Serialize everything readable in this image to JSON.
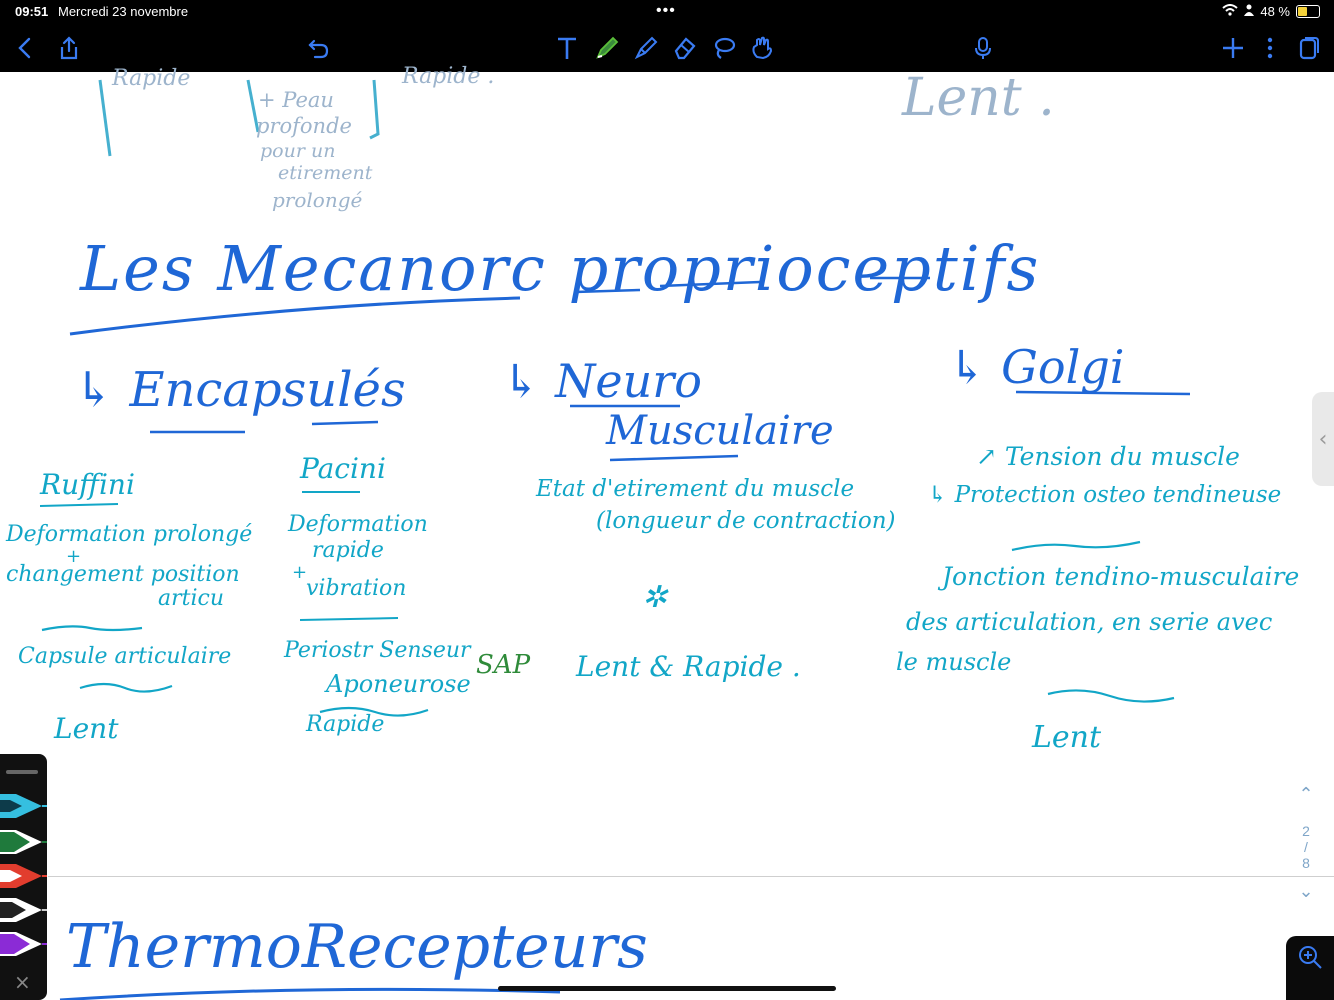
{
  "status": {
    "time": "09:51",
    "date": "Mercredi 23 novembre",
    "battery": "48 %",
    "dots": "•••"
  },
  "toolbar": {
    "left": [
      "back-icon",
      "share-icon",
      "undo-icon"
    ],
    "tools": [
      "text-tool-icon",
      "pen-tool-icon",
      "highlighter-tool-icon",
      "eraser-tool-icon",
      "lasso-tool-icon",
      "hand-tool-icon"
    ],
    "right": [
      "microphone-icon",
      "add-icon",
      "more-icon",
      "pages-icon"
    ]
  },
  "colors": {
    "ink_blue": "#1f67d6",
    "ink_cyan": "#12a6c7",
    "ink_faded": "#9db4cc",
    "ink_green": "#2f8b3a",
    "pen_cyan": "#35bfe0",
    "pen_green": "#1f7a3c",
    "pen_red": "#e23d2e",
    "pen_black": "#222222",
    "pen_purple": "#8b2bd6"
  },
  "notes": {
    "top_faded": {
      "rapide": "Rapide",
      "peau": "+ Peau",
      "profonde": "profonde",
      "pour_un": "pour un",
      "etirement": "etirement",
      "prolonge": "prolongé",
      "rapide2": "Rapide .",
      "lent": "Lent ."
    },
    "title": "Les Mecanorc proprioceptifs",
    "sections": {
      "encapsules": "↳ Encapsulés",
      "neuro": "↳ Neuro",
      "musculaire": "Musculaire",
      "golgi": "↳ Golgi"
    },
    "ruffini": {
      "name": "Ruffini",
      "line1": "Deformation prolongé",
      "plus": "+",
      "line2": "changement position",
      "line3": "articu",
      "location": "Capsule articulaire",
      "speed": "Lent"
    },
    "pacini": {
      "name": "Pacini",
      "line1": "Deformation",
      "line2": "rapide",
      "plus": "+",
      "line3": "vibration",
      "location": "Periostr Senseur",
      "location2": "Aponeurose",
      "sap": "SAP",
      "speed": "Rapide"
    },
    "neuro": {
      "line1": "Etat d'etirement du muscle",
      "line2": "(longueur de contraction)",
      "star": "✲",
      "speed": "Lent & Rapide ."
    },
    "golgi": {
      "line1": "↗ Tension du muscle",
      "line2": "↳ Protection osteo tendineuse",
      "line3": "Jonction tendino-musculaire",
      "line4": "des articulation, en serie avec",
      "line5": "le muscle",
      "speed": "Lent"
    },
    "next_page_title": "ThermoRecepteurs"
  },
  "pager": {
    "current": "2",
    "sep": "/",
    "total": "8"
  },
  "palette": {
    "close": "×"
  }
}
